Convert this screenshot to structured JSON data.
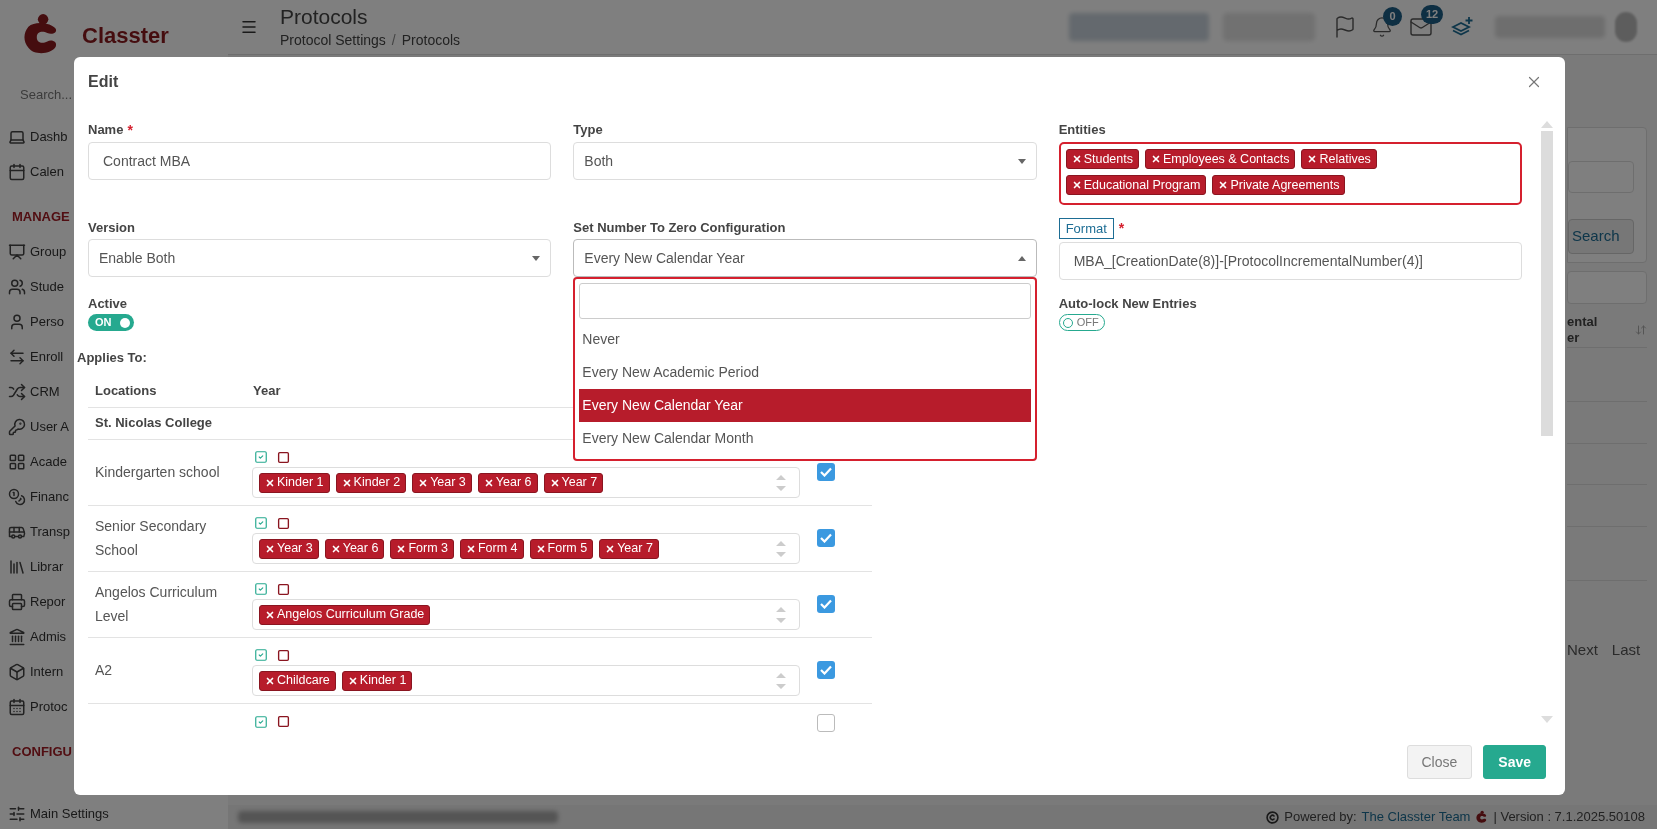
{
  "sidebar": {
    "logo": "Classter",
    "search_placeholder": "Search...",
    "items": [
      {
        "kind": "link",
        "label": "Dashb"
      },
      {
        "kind": "link",
        "label": "Calen"
      },
      {
        "kind": "heading",
        "label": "MANAGE"
      },
      {
        "kind": "link",
        "label": "Group"
      },
      {
        "kind": "link",
        "label": "Stude"
      },
      {
        "kind": "link",
        "label": "Perso"
      },
      {
        "kind": "link",
        "label": "Enroll"
      },
      {
        "kind": "link",
        "label": "CRM"
      },
      {
        "kind": "link",
        "label": "User A"
      },
      {
        "kind": "link",
        "label": "Acade"
      },
      {
        "kind": "link",
        "label": "Financ"
      },
      {
        "kind": "link",
        "label": "Transp"
      },
      {
        "kind": "link",
        "label": "Librar"
      },
      {
        "kind": "link",
        "label": "Repor"
      },
      {
        "kind": "link",
        "label": "Admis"
      },
      {
        "kind": "link",
        "label": "Intern"
      },
      {
        "kind": "link",
        "label": "Protoc"
      },
      {
        "kind": "heading",
        "label": "CONFIGU"
      }
    ],
    "bottom_item": "Main Settings"
  },
  "header": {
    "title": "Protocols",
    "breadcrumb": [
      "Protocol Settings",
      "Protocols"
    ],
    "separator": "/",
    "notifications": "0",
    "messages": "12"
  },
  "background": {
    "search_button": "Search",
    "column_header": [
      "ental",
      "er"
    ],
    "pagination": [
      "Next",
      "Last"
    ]
  },
  "footer": {
    "powered_by": "Powered by:",
    "team": "The Classter Team",
    "version": "| Version : 7.1.2025.50108"
  },
  "modal": {
    "title": "Edit",
    "name": {
      "label": "Name",
      "required_mark": "*",
      "value": "Contract MBA"
    },
    "type": {
      "label": "Type",
      "value": "Both",
      "expanded": false
    },
    "entities": {
      "label": "Entities",
      "tags": [
        "Students",
        "Employees & Contacts",
        "Relatives",
        "Educational Program",
        "Private Agreements"
      ]
    },
    "version": {
      "label": "Version",
      "value": "Enable Both",
      "expanded": false
    },
    "reset_config": {
      "label": "Set Number To Zero Configuration",
      "value": "Every New Calendar Year",
      "expanded": true,
      "options": [
        {
          "label": "Never",
          "selected": false
        },
        {
          "label": "Every New Academic Period",
          "selected": false
        },
        {
          "label": "Every New Calendar Year",
          "selected": true
        },
        {
          "label": "Every New Calendar Month",
          "selected": false
        }
      ]
    },
    "format": {
      "label": "Format",
      "required_mark": "*",
      "value": "MBA_[CreationDate(8)]-[ProtocolIncrementalNumber(4)]"
    },
    "active": {
      "label": "Active",
      "on": true,
      "state_text": "ON"
    },
    "auto_lock": {
      "label": "Auto-lock New Entries",
      "on": false,
      "state_text": "OFF"
    },
    "applies_to": {
      "label": "Applies To:",
      "columns": [
        "Locations",
        "Year"
      ],
      "group": "St. Nicolas College",
      "rows": [
        {
          "location": "Kindergarten school",
          "years": [
            "Kinder 1",
            "Kinder 2",
            "Year 3",
            "Year 6",
            "Year 7"
          ],
          "checked": true
        },
        {
          "location": "Senior Secondary School",
          "years": [
            "Year 3",
            "Year 6",
            "Form 3",
            "Form 4",
            "Form 5",
            "Year 7"
          ],
          "checked": true
        },
        {
          "location": "Angelos Curriculum Level",
          "years": [
            "Angelos Curriculum Grade"
          ],
          "checked": true
        },
        {
          "location": "A2",
          "years": [
            "Childcare",
            "Kinder 1"
          ],
          "checked": true
        },
        {
          "checked": false
        }
      ]
    },
    "buttons": [
      {
        "label": "Close",
        "kind": "secondary"
      },
      {
        "label": "Save",
        "kind": "primary"
      }
    ]
  }
}
